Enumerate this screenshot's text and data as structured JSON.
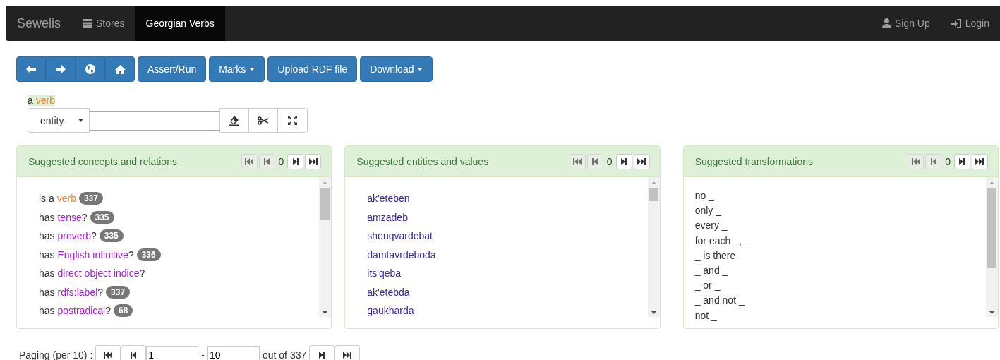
{
  "navbar": {
    "brand": "Sewelis",
    "items": [
      {
        "label": "Stores",
        "selected": false
      },
      {
        "label": "Georgian Verbs",
        "selected": true
      }
    ],
    "right": [
      {
        "label": "Sign Up"
      },
      {
        "label": "Login"
      }
    ]
  },
  "toolbar": {
    "buttons": [
      {
        "label": "Assert/Run",
        "caret": false
      },
      {
        "label": "Marks",
        "caret": true
      },
      {
        "label": "Upload RDF file",
        "caret": false
      },
      {
        "label": "Download",
        "caret": true
      }
    ]
  },
  "query": {
    "prefix": "a",
    "term": "verb"
  },
  "entry": {
    "select": "entity"
  },
  "panels": [
    {
      "kind": "concepts",
      "title": "Suggested concepts and relations",
      "pager": {
        "count": "0",
        "first_disabled": true,
        "prev_disabled": true,
        "next_disabled": false,
        "last_disabled": false
      },
      "items": [
        {
          "prefix": "is a",
          "term": "verb",
          "kind": "class",
          "count": "337"
        },
        {
          "prefix": "has",
          "term": "tense",
          "kind": "property",
          "suffix": "?",
          "count": "335"
        },
        {
          "prefix": "has",
          "term": "preverb",
          "kind": "property",
          "suffix": "?",
          "count": "335"
        },
        {
          "prefix": "has",
          "term": "English infinitive",
          "kind": "property",
          "suffix": "?",
          "count": "336"
        },
        {
          "prefix": "has",
          "term": "direct object indice",
          "kind": "property",
          "suffix": "?"
        },
        {
          "prefix": "has",
          "term": "rdfs:label",
          "kind": "property",
          "suffix": "?",
          "count": "337"
        },
        {
          "prefix": "has",
          "term": "postradical",
          "kind": "property",
          "suffix": "?",
          "count": "68"
        }
      ]
    },
    {
      "kind": "entities",
      "title": "Suggested entities and values",
      "pager": {
        "count": "0",
        "first_disabled": true,
        "prev_disabled": true,
        "next_disabled": false,
        "last_disabled": false
      },
      "items": [
        "ak'eteben",
        "amzadeb",
        "sheuqvardebat",
        "damtavrdeboda",
        "its'qeba",
        "ak'etebda",
        "gaukharda"
      ]
    },
    {
      "kind": "transformations",
      "title": "Suggested transformations",
      "pager": {
        "count": "0",
        "first_disabled": true,
        "prev_disabled": true,
        "next_disabled": false,
        "last_disabled": false
      },
      "items": [
        "no _",
        "only _",
        "every _",
        "for each _, _",
        "_ is there",
        "_ and _",
        "_ or _",
        "_ and not _",
        "not _"
      ]
    }
  ],
  "paging": {
    "label": "Paging (per 10) :",
    "from": "1",
    "separator": "-",
    "to": "10",
    "total": "out of 337"
  }
}
